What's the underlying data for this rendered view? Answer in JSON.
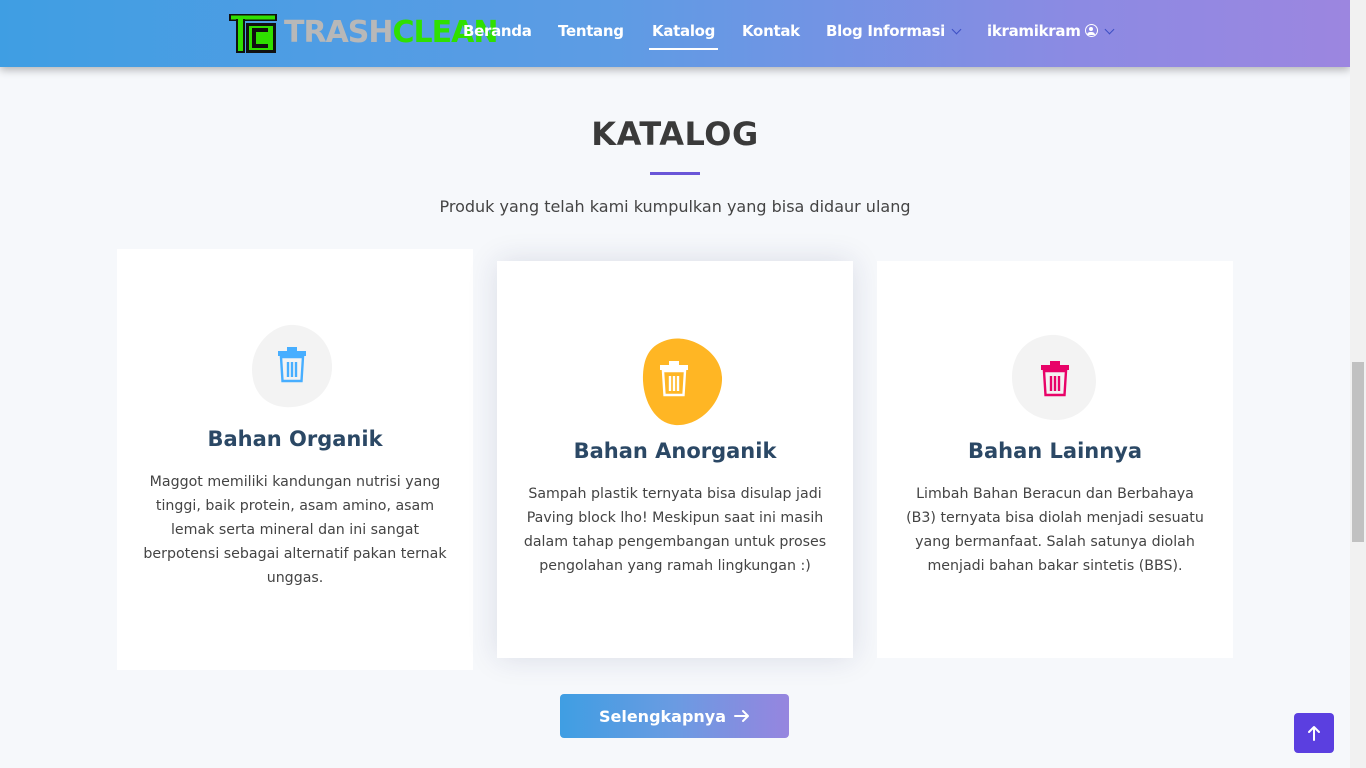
{
  "header": {
    "logo": {
      "text_part1": "TRASH",
      "text_part2": "CLEAN"
    },
    "nav": [
      {
        "label": "Beranda"
      },
      {
        "label": "Tentang"
      },
      {
        "label": "Katalog",
        "active": true
      },
      {
        "label": "Kontak"
      },
      {
        "label": "Blog Informasi",
        "dropdown": true
      },
      {
        "label": "ikramikram",
        "dropdown": true,
        "icon": "user-circle-icon"
      }
    ]
  },
  "section": {
    "title": "KATALOG",
    "subtitle": "Produk yang telah kami kumpulkan yang bisa didaur ulang"
  },
  "cards": [
    {
      "title": "Bahan Organik",
      "icon": "trash-icon",
      "icon_color": "#47aeff",
      "blob_color": "#f3f3f3",
      "text": "Maggot memiliki kandungan nutrisi yang tinggi, baik protein, asam amino, asam lemak serta mineral dan ini sangat berpotensi sebagai alternatif pakan ternak unggas."
    },
    {
      "title": "Bahan Anorganik",
      "icon": "trash-icon",
      "icon_color": "#ffffff",
      "blob_color": "#ffb624",
      "text": "Sampah plastik ternyata bisa disulap jadi Paving block lho! Meskipun saat ini masih dalam tahap pengembangan untuk proses pengolahan yang ramah lingkungan :)"
    },
    {
      "title": "Bahan Lainnya",
      "icon": "trash-icon",
      "icon_color": "#e80368",
      "blob_color": "#f3f3f3",
      "text": "Limbah Bahan Beracun dan Berbahaya (B3) ternyata bisa diolah menjadi sesuatu yang bermanfaat. Salah satunya diolah menjadi bahan bakar sintetis (BBS)."
    }
  ],
  "more_button": {
    "label": "Selengkapnya",
    "icon": "arrow-right-icon"
  },
  "back_to_top": {
    "icon": "arrow-up-icon",
    "color": "#5b3fe0"
  }
}
